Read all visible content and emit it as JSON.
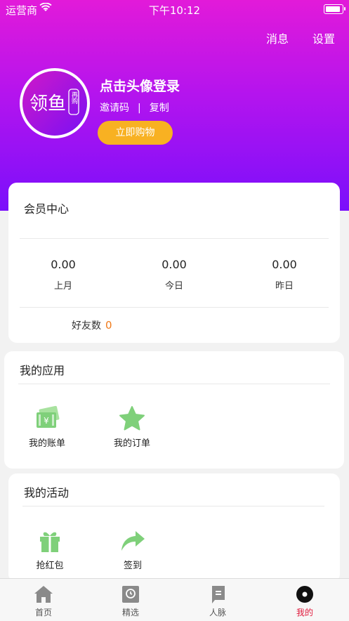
{
  "status_bar": {
    "carrier": "运营商",
    "time": "下午10:12",
    "battery_level": 1.0
  },
  "header": {
    "messages_label": "消息",
    "settings_label": "设置",
    "login_title": "点击头像登录",
    "invite_code_label": "邀请码",
    "separator": "|",
    "copy_label": "复制",
    "shop_button_label": "立即购物",
    "logo_text": "领鱼",
    "logo_badge": "再购"
  },
  "member_center": {
    "title": "会员中心",
    "stats": [
      {
        "value": "0.00",
        "label": "上月"
      },
      {
        "value": "0.00",
        "label": "今日"
      },
      {
        "value": "0.00",
        "label": "昨日"
      }
    ],
    "friends_label": "好友数",
    "friends_count": "0"
  },
  "my_apps": {
    "title": "我的应用",
    "items": [
      {
        "label": "我的账单",
        "icon": "bill-icon"
      },
      {
        "label": "我的订单",
        "icon": "star-icon"
      }
    ]
  },
  "my_activities": {
    "title": "我的活动",
    "items": [
      {
        "label": "抢红包",
        "icon": "gift-icon"
      },
      {
        "label": "签到",
        "icon": "share-arrow-icon"
      }
    ]
  },
  "tabbar": {
    "items": [
      {
        "label": "首页",
        "icon": "home-icon",
        "active": false
      },
      {
        "label": "精选",
        "icon": "featured-icon",
        "active": false
      },
      {
        "label": "人脉",
        "icon": "contacts-icon",
        "active": false
      },
      {
        "label": "我的",
        "icon": "profile-icon",
        "active": true
      }
    ]
  },
  "colors": {
    "accent": "#f8b122",
    "active_tab": "#e01a3c",
    "icon_green": "#7fd07a",
    "friends_count": "#f07b1c"
  }
}
